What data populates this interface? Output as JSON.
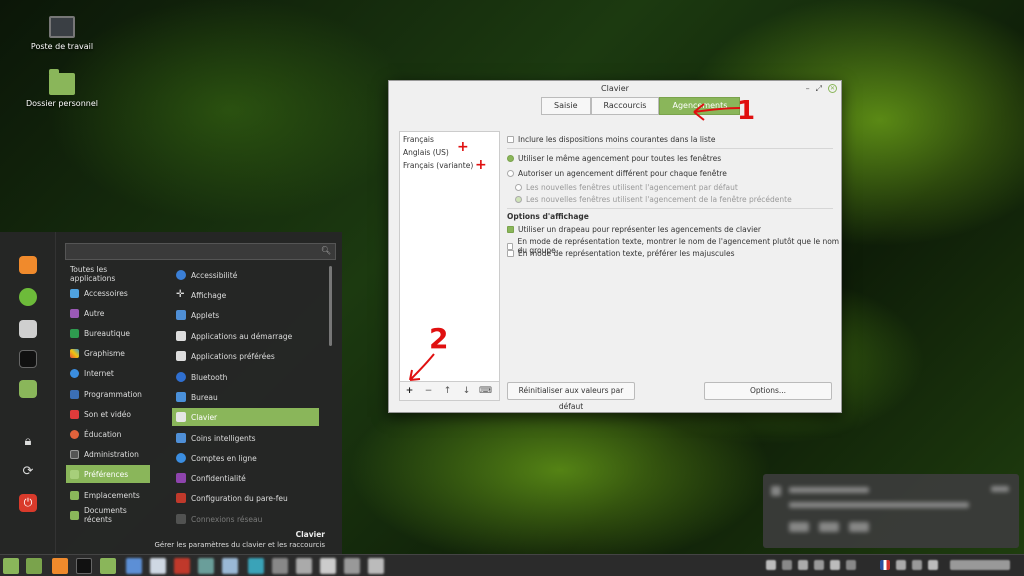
{
  "desktop": {
    "icons": [
      {
        "label": "Poste de travail",
        "icon": "computer-icon"
      },
      {
        "label": "Dossier personnel",
        "icon": "home-folder-icon"
      }
    ]
  },
  "window": {
    "title": "Clavier",
    "tabs": [
      "Saisie",
      "Raccourcis",
      "Agencements"
    ],
    "active_tab": "Agencements",
    "layouts": [
      "Français",
      "Anglais (US)",
      "Français (variante)"
    ],
    "toolbar": {
      "add": "+",
      "remove": "−",
      "up": "↑",
      "down": "↓",
      "keyboard": "⌨"
    },
    "options": {
      "include_less_common": "Inclure les dispositions moins courantes dans la liste",
      "same_layout": "Utiliser le même agencement pour toutes les fenêtres",
      "different_layout": "Autoriser un agencement différent pour chaque fenêtre",
      "new_windows_default": "Les nouvelles fenêtres utilisent l'agencement par défaut",
      "new_windows_previous": "Les nouvelles fenêtres utilisent l'agencement de la fenêtre précédente"
    },
    "display_section": "Options d'affichage",
    "display": {
      "use_flag": "Utiliser un drapeau pour représenter les agencements de clavier",
      "text_group": "En mode de représentation texte, montrer le nom de l'agencement plutôt que le nom du groupe",
      "text_uppercase": "En mode de représentation texte, préférer les majuscules"
    },
    "reset_button": "Réinitialiser aux valeurs par défaut",
    "options_button": "Options..."
  },
  "annotations": {
    "one": "1",
    "two": "2",
    "plus": "+"
  },
  "menu": {
    "search_placeholder": "",
    "categories": [
      "Toutes les applications",
      "Accessoires",
      "Autre",
      "Bureautique",
      "Graphisme",
      "Internet",
      "Programmation",
      "Son et vidéo",
      "Éducation",
      "Administration",
      "Préférences",
      "Emplacements",
      "Documents récents"
    ],
    "active_category": "Préférences",
    "apps": [
      "Accessibilité",
      "Affichage",
      "Applets",
      "Applications au démarrage",
      "Applications préférées",
      "Bluetooth",
      "Bureau",
      "Clavier",
      "Coins intelligents",
      "Comptes en ligne",
      "Confidentialité",
      "Configuration du pare-feu",
      "Connexions réseau"
    ],
    "active_app": "Clavier",
    "description_title": "Clavier",
    "description": "Gérer les paramètres du clavier et les raccourcis"
  },
  "colors": {
    "accent": "#8ab65a",
    "annotation": "#e01010"
  }
}
